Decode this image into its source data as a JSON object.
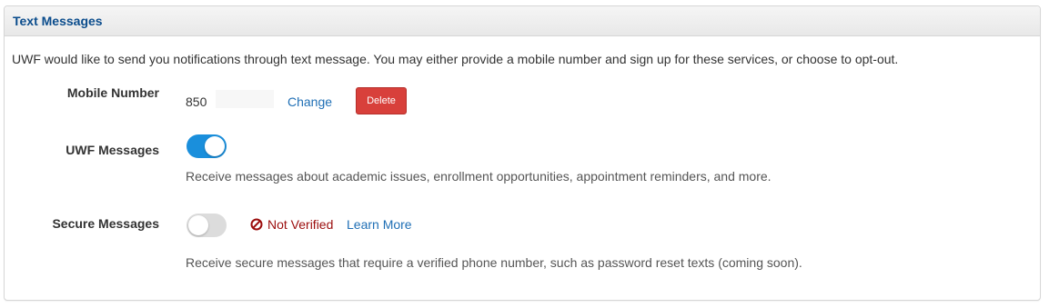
{
  "header": {
    "title": "Text Messages"
  },
  "intro_text": "UWF would like to send you notifications through text message. You may either provide a mobile number and sign up for these services, or choose to opt-out.",
  "mobile": {
    "label": "Mobile Number",
    "number": "850",
    "change_label": "Change",
    "delete_label": "Delete"
  },
  "uwf_messages": {
    "label": "UWF Messages",
    "enabled": true,
    "description": "Receive messages about academic issues, enrollment opportunities, appointment reminders, and more."
  },
  "secure_messages": {
    "label": "Secure Messages",
    "enabled": false,
    "status_text": "Not Verified",
    "status_icon": "prohibited-icon",
    "learn_more_label": "Learn More",
    "description": "Receive secure messages that require a verified phone number, such as password reset texts (coming soon)."
  },
  "colors": {
    "title": "#0a4c8c",
    "link": "#1f6fb5",
    "delete_button": "#d8403b",
    "toggle_on": "#1a8fdc",
    "toggle_off": "#dcdcdc",
    "not_verified": "#9b0d0d"
  }
}
